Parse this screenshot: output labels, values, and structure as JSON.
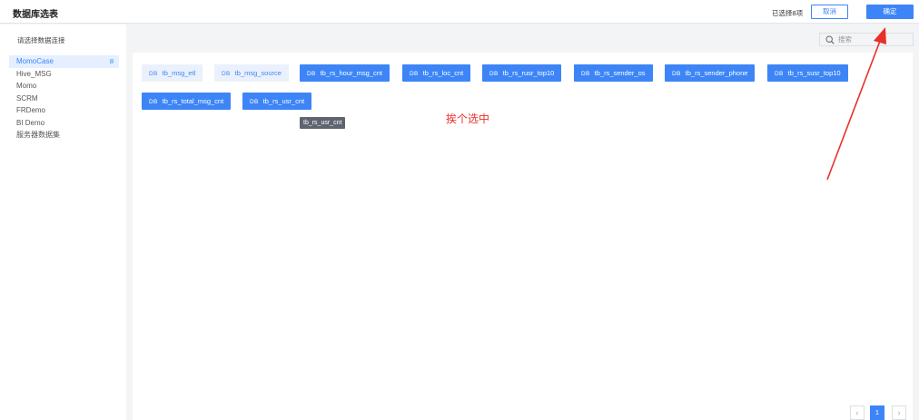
{
  "header": {
    "title": "数据库选表",
    "selected_count": "已选择8项",
    "cancel_label": "取消",
    "confirm_label": "确定"
  },
  "sidebar": {
    "heading": "请选择数据连接",
    "items": [
      {
        "label": "MomoCase",
        "count": "8",
        "active": true
      },
      {
        "label": "Hive_MSG"
      },
      {
        "label": "Momo"
      },
      {
        "label": "SCRM"
      },
      {
        "label": "FRDemo"
      },
      {
        "label": "BI Demo"
      },
      {
        "label": "服务器数据集"
      }
    ]
  },
  "search": {
    "placeholder": "搜索"
  },
  "tables": {
    "db_badge": "DB",
    "items": [
      {
        "label": "tb_msg_etl",
        "selected": false
      },
      {
        "label": "tb_msg_source",
        "selected": false
      },
      {
        "label": "tb_rs_hour_msg_cnt",
        "selected": true
      },
      {
        "label": "tb_rs_loc_cnt",
        "selected": true
      },
      {
        "label": "tb_rs_rusr_top10",
        "selected": true
      },
      {
        "label": "tb_rs_sender_os",
        "selected": true
      },
      {
        "label": "tb_rs_sender_phone",
        "selected": true
      },
      {
        "label": "tb_rs_susr_top10",
        "selected": true
      },
      {
        "label": "tb_rs_total_msg_cnt",
        "selected": true
      },
      {
        "label": "tb_rs_usr_cnt",
        "selected": true
      }
    ]
  },
  "tooltip": {
    "text": "tb_rs_usr_cnt"
  },
  "annotation": {
    "text": "挨个选中",
    "color": "#e8302a"
  },
  "pagination": {
    "current_page": "1",
    "prev_symbol": "‹",
    "next_symbol": "›"
  },
  "colors": {
    "accent": "#3d85f7",
    "chip_unselected_bg": "#eaf1fd",
    "annotation_red": "#e8302a"
  }
}
